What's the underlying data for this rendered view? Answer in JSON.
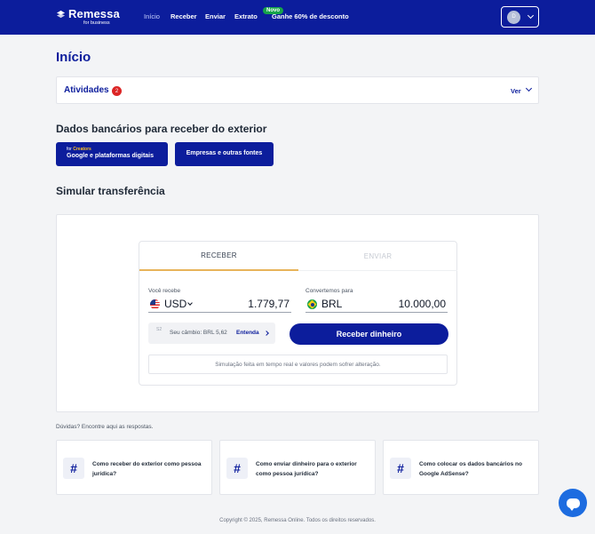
{
  "header": {
    "logo_text": "Remessa",
    "logo_sub": "for business",
    "nav": [
      {
        "label": "Início",
        "active": true
      },
      {
        "label": "Receber"
      },
      {
        "label": "Enviar"
      },
      {
        "label": "Extrato"
      },
      {
        "label": "Ganhe 60% de desconto"
      }
    ],
    "badge": "Novo",
    "avatar_initial": "D"
  },
  "page": {
    "title": "Início"
  },
  "activities": {
    "label": "Atividades",
    "count": "2",
    "toggle": "Ver"
  },
  "bank": {
    "title": "Dados bancários para receber do exterior",
    "btn1_small_prefix": "for ",
    "btn1_small_highlight": "Creators",
    "btn1_label": "Google e plataformas digitais",
    "btn2_label": "Empresas e outras fontes"
  },
  "simulate": {
    "title": "Simular transferência",
    "tabs": [
      {
        "label": "RECEBER",
        "active": true
      },
      {
        "label": "ENVIAR"
      }
    ],
    "receive_label": "Você recebe",
    "receive_currency": "USD",
    "receive_amount": "1.779,77",
    "convert_label": "Convertemos para",
    "convert_currency": "BRL",
    "convert_amount": "10.000,00",
    "rate_icon_text": "S2",
    "rate_text": "Seu câmbio: BRL 5,62",
    "rate_link": "Entenda",
    "cta": "Receber dinheiro",
    "note": "Simulação feita em tempo real e valores podem sofrer alteração."
  },
  "faq": {
    "title": "Dúvidas? Encontre aqui as respostas.",
    "items": [
      {
        "text": "Como receber do exterior como pessoa jurídica?"
      },
      {
        "text": "Como enviar dinheiro para o exterior como pessoa jurídica?"
      },
      {
        "text": "Como colocar os dados bancários no Google AdSense?"
      }
    ]
  },
  "footer": {
    "copyright": "Copyright © 2025, Remessa Online. Todos os direitos reservados."
  },
  "colors": {
    "brand": "#0c1d9c",
    "accent_tab": "#e8b45a",
    "badge_green": "#16a34a",
    "alert_red": "#dc2626",
    "chat_blue": "#1d6ce0"
  }
}
